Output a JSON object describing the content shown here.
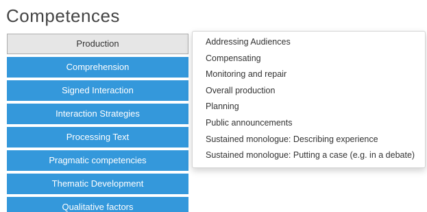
{
  "page": {
    "title": "Competences"
  },
  "categories": [
    {
      "label": "Production",
      "active": true
    },
    {
      "label": "Comprehension",
      "active": false
    },
    {
      "label": "Signed Interaction",
      "active": false
    },
    {
      "label": "Interaction Strategies",
      "active": false
    },
    {
      "label": "Processing Text",
      "active": false
    },
    {
      "label": "Pragmatic competencies",
      "active": false
    },
    {
      "label": "Thematic Development",
      "active": false
    },
    {
      "label": "Qualitative factors",
      "active": false
    }
  ],
  "dropdown": {
    "items": [
      "Addressing Audiences",
      "Compensating",
      "Monitoring and repair",
      "Overall production",
      "Planning",
      "Public announcements",
      "Sustained monologue: Describing experience",
      "Sustained monologue: Putting a case (e.g. in a debate)"
    ]
  },
  "colors": {
    "button_bg": "#3498db",
    "active_bg": "#e6e6e6",
    "title_text": "#444444"
  }
}
